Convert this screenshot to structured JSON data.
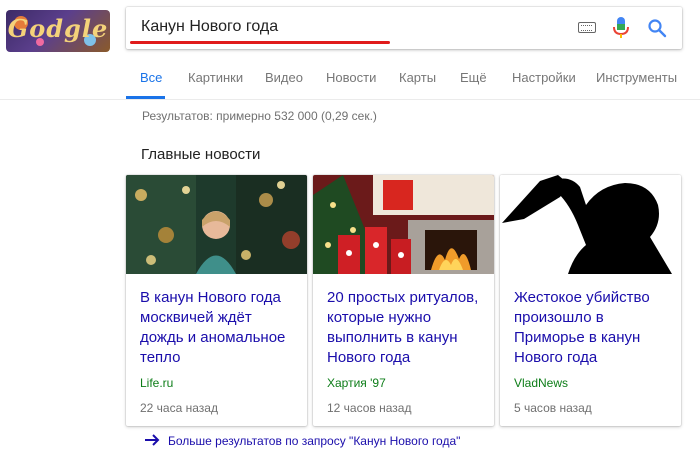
{
  "logo": {
    "alt_text": "Google Doodle"
  },
  "search": {
    "query": "Канун Нового года",
    "keyboard_icon": "keyboard-icon",
    "mic_icon": "mic-icon",
    "search_icon": "search-icon"
  },
  "tabs": [
    {
      "label": "Все",
      "active": true
    },
    {
      "label": "Картинки",
      "active": false
    },
    {
      "label": "Видео",
      "active": false
    },
    {
      "label": "Новости",
      "active": false
    },
    {
      "label": "Карты",
      "active": false
    },
    {
      "label": "Ещё",
      "active": false
    },
    {
      "label": "Настройки",
      "active": false
    },
    {
      "label": "Инструменты",
      "active": false
    }
  ],
  "results": {
    "stats": "Результатов: примерно 532 000 (0,29 сек.)"
  },
  "news": {
    "title": "Главные новости",
    "cards": [
      {
        "title": "В канун Нового года москвичей ждёт дождь и аномальное тепло",
        "source": "Life.ru",
        "time": "22 часа назад"
      },
      {
        "title": "20 простых ритуалов, которые нужно выполнить в канун Нового года",
        "source": "Хартия '97",
        "time": "12 часов назад"
      },
      {
        "title": "Жестокое убийство произошло в Приморье в канун Нового года",
        "source": "VladNews",
        "time": "5 часов назад"
      }
    ],
    "more_label": "Больше результатов по запросу \"Канун Нового года\""
  },
  "colors": {
    "link": "#1a0dab",
    "accent": "#1a73e8",
    "source_green": "#0d7d18",
    "underline_red": "#e01b1b"
  }
}
